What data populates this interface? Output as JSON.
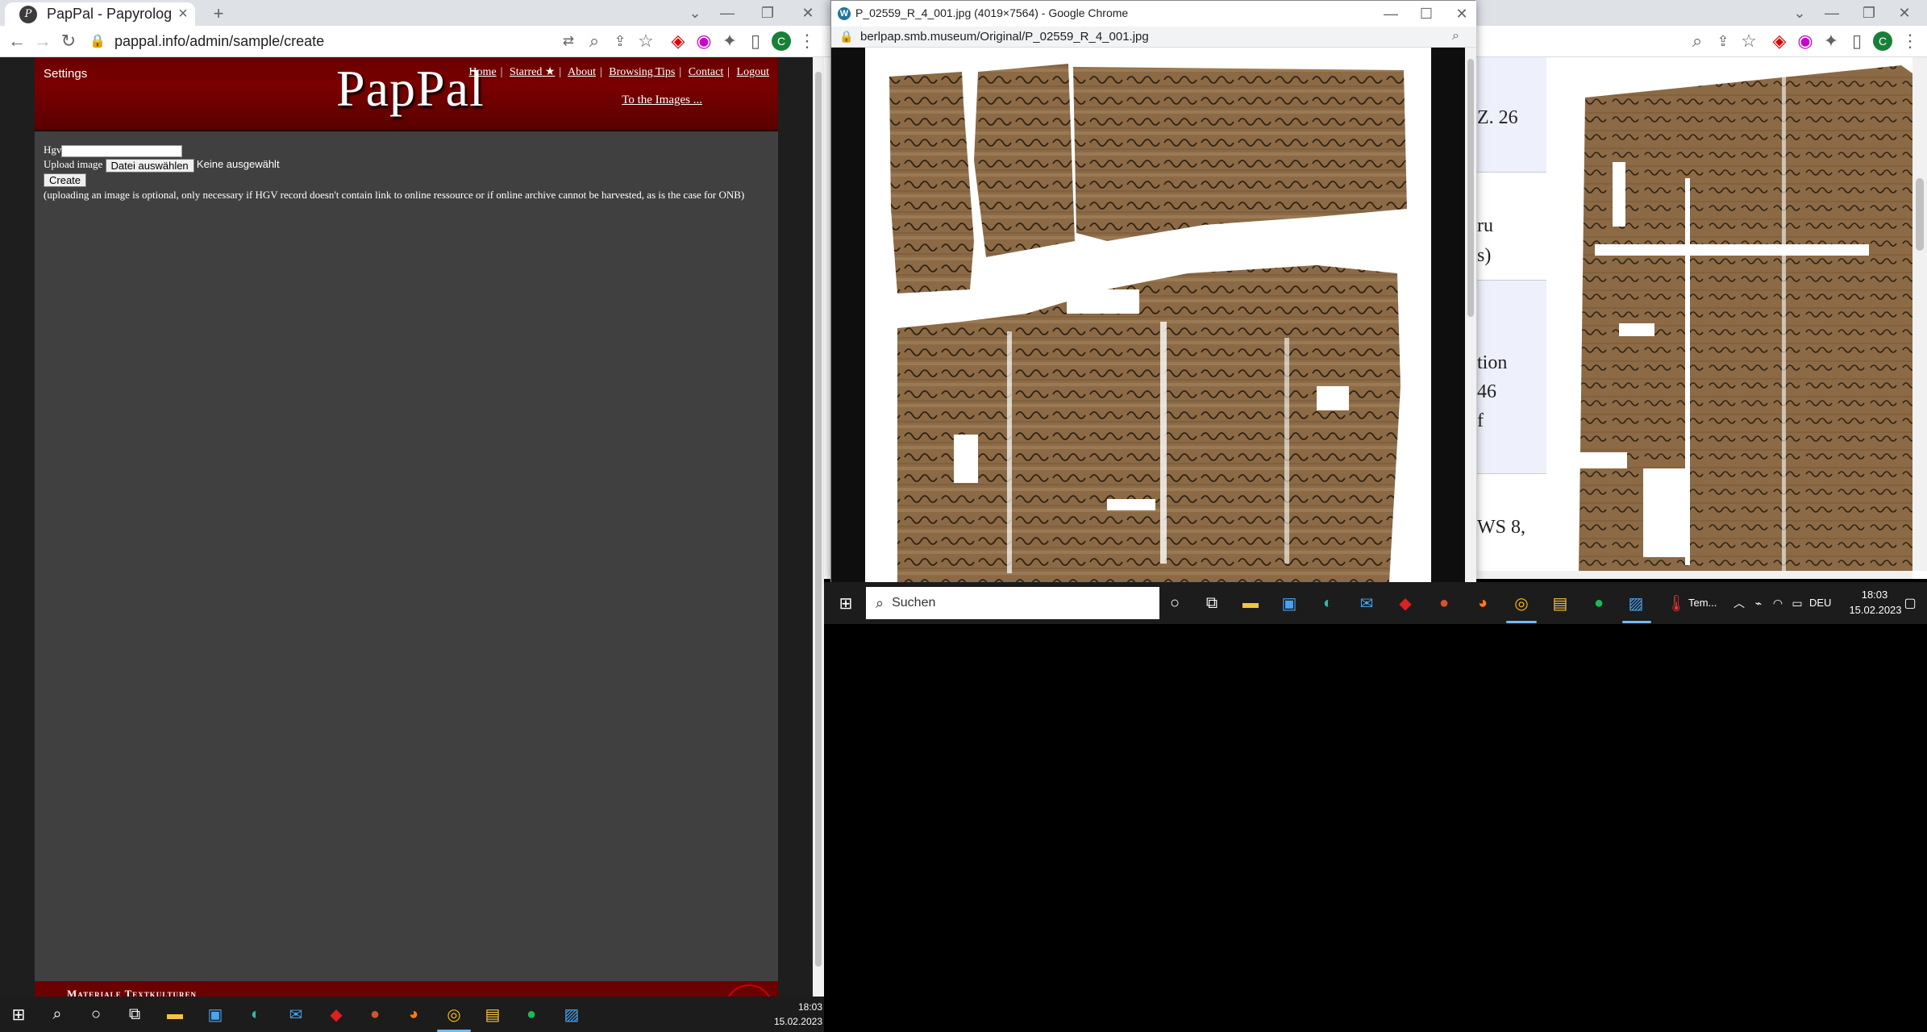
{
  "left_browser": {
    "tab_title": "PapPal - Papyrology | Paleograph",
    "url": "pappal.info/admin/sample/create",
    "profile_initial": "C"
  },
  "pappal": {
    "settings": "Settings",
    "logo": "PapPal",
    "nav": [
      "Home",
      "Starred ★",
      "About",
      "Browsing Tips",
      "Contact",
      "Logout"
    ],
    "to_images": "To the Images ...",
    "form": {
      "hgv_label": "Hgv",
      "upload_label": "Upload image",
      "file_button": "Datei auswählen",
      "file_status": "Keine ausgewählt",
      "create_button": "Create",
      "note": "(uploading an image is optional, only necessary if HGV record doesn't contain link to online ressource or if online archive cannot be harvested, as is the case for ONB)"
    },
    "footer_text": "Materiale Textkulturen"
  },
  "popup": {
    "title": "P_02559_R_4_001.jpg (4019×7564) - Google Chrome",
    "url": "berlpap.smb.museum/Original/P_02559_R_4_001.jpg"
  },
  "right_browser": {
    "profile_initial": "C",
    "cells": [
      "Z. 26",
      "ru",
      "s)",
      "tion",
      "46",
      "f",
      "WS 8,"
    ]
  },
  "right_taskbar": {
    "search_placeholder": "Suchen",
    "weather": "Tem...",
    "language": "DEU",
    "time": "18:03",
    "date": "15.02.2023"
  },
  "left_taskbar": {
    "time": "18:03",
    "date": "15.02.2023"
  },
  "colors": {
    "pappal_red": "#6a0000",
    "pappal_bg": "#404040",
    "papyrus": "#8b6a45",
    "taskbar": "#1c1c1c",
    "accent": "#76b9ed"
  }
}
